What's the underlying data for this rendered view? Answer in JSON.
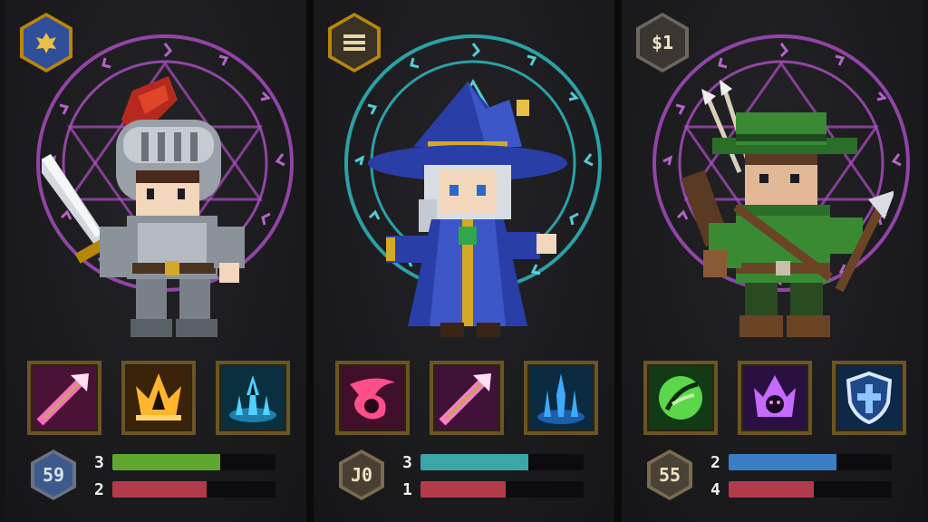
{
  "heroes": [
    {
      "name": "knight",
      "emblem": {
        "type": "crest-icon",
        "text": "",
        "color": "#2f4f9a"
      },
      "rune_color": "#b04fc8",
      "skills": [
        {
          "icon": "arrow-strike-icon",
          "bg": "#4a1236",
          "accent": "#ff66c4"
        },
        {
          "icon": "fire-burst-icon",
          "bg": "#3a2308",
          "accent": "#ffb52e"
        },
        {
          "icon": "ice-spikes-icon",
          "bg": "#0a3040",
          "accent": "#4fd2ff"
        }
      ],
      "level": "59",
      "level_color": "#3d5a8c",
      "stats": [
        {
          "value": "3",
          "fill": 0.66,
          "color": "#5ea830"
        },
        {
          "value": "2",
          "fill": 0.58,
          "color": "#b23b4a"
        }
      ]
    },
    {
      "name": "wizard",
      "emblem": {
        "type": "menu-icon",
        "text": "",
        "color": "#3a3224"
      },
      "rune_color": "#2fb8c0",
      "skills": [
        {
          "icon": "crimson-slash-icon",
          "bg": "#40102a",
          "accent": "#ff4f8a"
        },
        {
          "icon": "arrow-strike-icon",
          "bg": "#401238",
          "accent": "#ff7ac9"
        },
        {
          "icon": "ice-spikes-icon",
          "bg": "#0a2a40",
          "accent": "#3fa8ff"
        }
      ],
      "level": "J0",
      "level_color": "#4a4032",
      "stats": [
        {
          "value": "3",
          "fill": 0.66,
          "color": "#3aa6a8"
        },
        {
          "value": "1",
          "fill": 0.52,
          "color": "#b23b4a"
        }
      ]
    },
    {
      "name": "ranger",
      "emblem": {
        "type": "coin-badge",
        "text": "$1",
        "color": "#3a3632"
      },
      "rune_color": "#b04fc8",
      "skills": [
        {
          "icon": "leaf-strike-icon",
          "bg": "#123a14",
          "accent": "#5cd64a"
        },
        {
          "icon": "shadow-flame-icon",
          "bg": "#2a1040",
          "accent": "#c46bff"
        },
        {
          "icon": "shield-cross-icon",
          "bg": "#0e2848",
          "accent": "#8fc4ff"
        }
      ],
      "level": "55",
      "level_color": "#4a4236",
      "stats": [
        {
          "value": "2",
          "fill": 0.66,
          "color": "#3a7fc4"
        },
        {
          "value": "4",
          "fill": 0.52,
          "color": "#b23b4a"
        }
      ]
    }
  ]
}
